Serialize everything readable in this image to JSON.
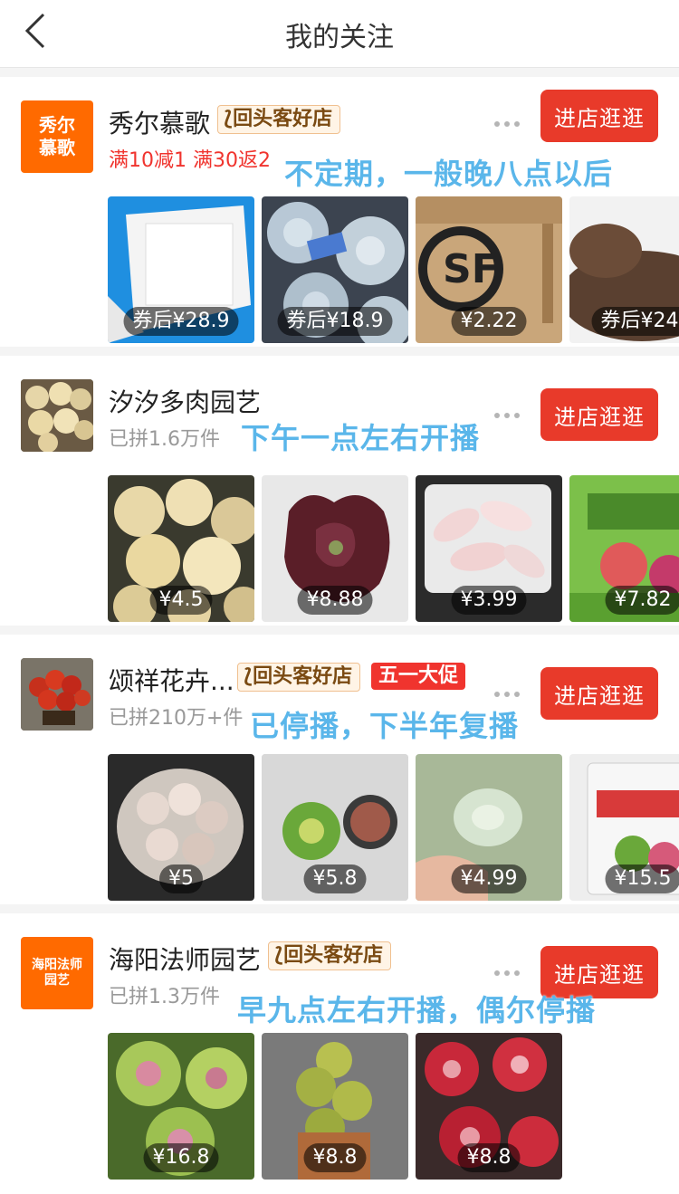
{
  "header": {
    "title": "我的关注"
  },
  "shops": [
    {
      "name": "秀尔慕歌",
      "avatar_text": "秀尔\n慕歌",
      "badges": {
        "repeat": "回头客好店"
      },
      "subtitle": "满10减1  满30返2",
      "enter_label": "进店逛逛",
      "note": "不定期，一般晚八点以后",
      "products": [
        {
          "price": "券后¥28.9"
        },
        {
          "price": "券后¥18.9"
        },
        {
          "price": "¥2.22"
        },
        {
          "price": "券后¥24."
        }
      ]
    },
    {
      "name": "汐汐多肉园艺",
      "subtitle": "已拼1.6万件",
      "enter_label": "进店逛逛",
      "note": "下午一点左右开播",
      "products": [
        {
          "price": "¥4.5"
        },
        {
          "price": "¥8.88"
        },
        {
          "price": "¥3.99"
        },
        {
          "price": "¥7.82"
        }
      ]
    },
    {
      "name": "颂祥花卉...",
      "badges": {
        "repeat": "回头客好店",
        "promo": "五一大促"
      },
      "subtitle": "已拼210万+件",
      "enter_label": "进店逛逛",
      "note": "已停播，下半年复播",
      "products": [
        {
          "price": "¥5"
        },
        {
          "price": "¥5.8"
        },
        {
          "price": "¥4.99"
        },
        {
          "price": "¥15.5"
        }
      ]
    },
    {
      "name": "海阳法师园艺",
      "avatar_text": "海阳法师\n园艺",
      "badges": {
        "repeat": "回头客好店"
      },
      "subtitle": "已拼1.3万件",
      "enter_label": "进店逛逛",
      "note": "早九点左右开播，偶尔停播",
      "products": [
        {
          "price": "¥16.8"
        },
        {
          "price": "¥8.8"
        },
        {
          "price": "¥8.8"
        }
      ]
    }
  ],
  "colors": {
    "accent": "#e83a2a",
    "note": "#5ab6ea",
    "avatar_orange": "#ff6a00"
  }
}
